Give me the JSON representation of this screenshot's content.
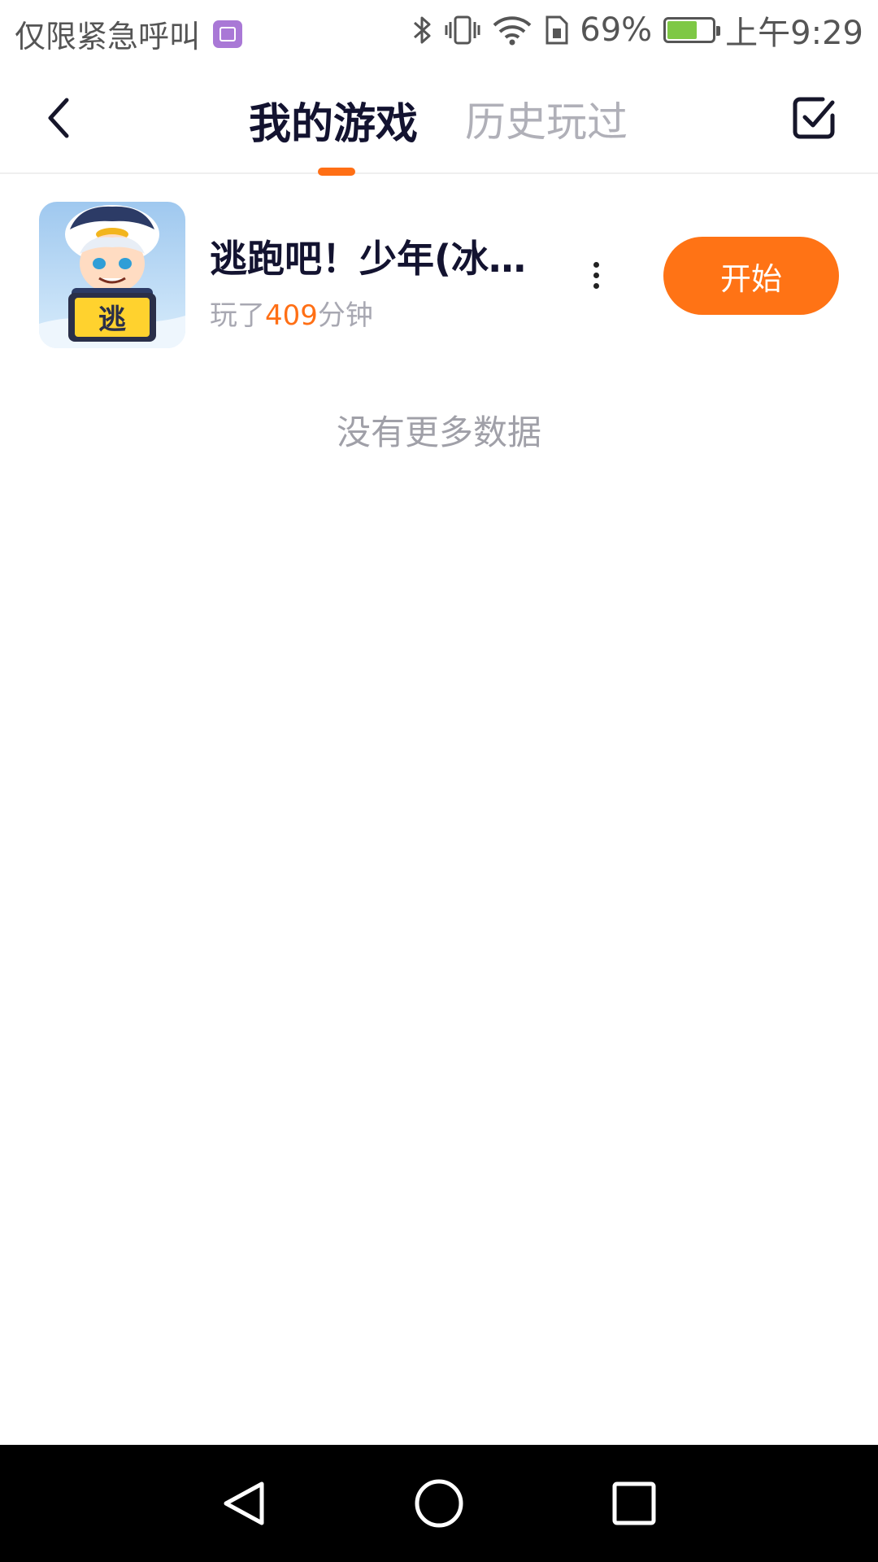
{
  "status_bar": {
    "carrier": "仅限紧急呼叫",
    "battery_percent": "69%",
    "battery_level": 0.69,
    "time": "上午9:29",
    "icons": [
      "gallery-notification-icon",
      "bluetooth-icon",
      "vibrate-icon",
      "wifi-icon",
      "sim-icon",
      "battery-icon"
    ]
  },
  "header": {
    "tabs": [
      {
        "label": "我的游戏",
        "active": true
      },
      {
        "label": "历史玩过",
        "active": false
      }
    ],
    "accent_color": "#ff6f15"
  },
  "games": [
    {
      "title": "逃跑吧！少年(冰雪...",
      "playtime_prefix": "玩了",
      "playtime_value": "409",
      "playtime_suffix": "分钟",
      "icon_text": "逃",
      "start_label": "开始"
    }
  ],
  "list_footer": "没有更多数据",
  "colors": {
    "primary": "#ff7315",
    "title_text": "#131330",
    "secondary_text": "#a8a8b2"
  }
}
